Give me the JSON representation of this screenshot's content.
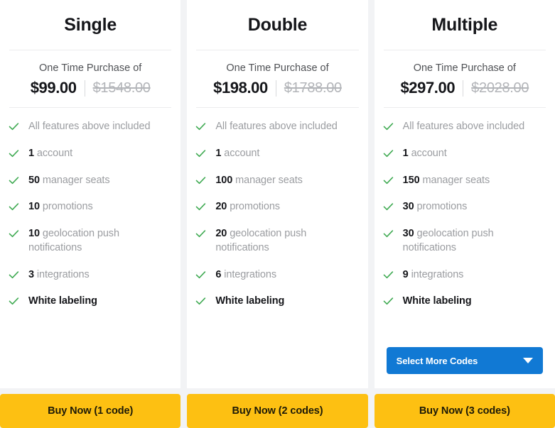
{
  "colors": {
    "accent_blue": "#1179d4",
    "buy_amber": "#fdc012",
    "check_green": "#3faa52",
    "page_bg": "#f2f3f5",
    "card_bg": "#ffffff"
  },
  "price_caption": "One Time Purchase of",
  "plans": [
    {
      "name": "Single",
      "price": "$99.00",
      "old_price": "$1548.00",
      "features": [
        {
          "value": "",
          "label": "All features above included",
          "emphasis": "muted"
        },
        {
          "value": "1",
          "label": "account",
          "emphasis": "value"
        },
        {
          "value": "50",
          "label": "manager seats",
          "emphasis": "value"
        },
        {
          "value": "10",
          "label": "promotions",
          "emphasis": "value"
        },
        {
          "value": "10",
          "label": "geolocation push notifications",
          "emphasis": "value"
        },
        {
          "value": "3",
          "label": "integrations",
          "emphasis": "value"
        },
        {
          "value": "",
          "label": "White labeling",
          "emphasis": "strong"
        }
      ],
      "has_select_more": false,
      "select_more_label": "",
      "buy_label": "Buy Now (1 code)"
    },
    {
      "name": "Double",
      "price": "$198.00",
      "old_price": "$1788.00",
      "features": [
        {
          "value": "",
          "label": "All features above included",
          "emphasis": "muted"
        },
        {
          "value": "1",
          "label": "account",
          "emphasis": "value"
        },
        {
          "value": "100",
          "label": "manager seats",
          "emphasis": "value"
        },
        {
          "value": "20",
          "label": "promotions",
          "emphasis": "value"
        },
        {
          "value": "20",
          "label": "geolocation push notifications",
          "emphasis": "value"
        },
        {
          "value": "6",
          "label": "integrations",
          "emphasis": "value"
        },
        {
          "value": "",
          "label": "White labeling",
          "emphasis": "strong"
        }
      ],
      "has_select_more": false,
      "select_more_label": "",
      "buy_label": "Buy Now (2 codes)"
    },
    {
      "name": "Multiple",
      "price": "$297.00",
      "old_price": "$2028.00",
      "features": [
        {
          "value": "",
          "label": "All features above included",
          "emphasis": "muted"
        },
        {
          "value": "1",
          "label": "account",
          "emphasis": "value"
        },
        {
          "value": "150",
          "label": "manager seats",
          "emphasis": "value"
        },
        {
          "value": "30",
          "label": "promotions",
          "emphasis": "value"
        },
        {
          "value": "30",
          "label": "geolocation push notifications",
          "emphasis": "value"
        },
        {
          "value": "9",
          "label": "integrations",
          "emphasis": "value"
        },
        {
          "value": "",
          "label": "White labeling",
          "emphasis": "strong"
        }
      ],
      "has_select_more": true,
      "select_more_label": "Select More Codes",
      "buy_label": "Buy Now (3 codes)"
    }
  ]
}
